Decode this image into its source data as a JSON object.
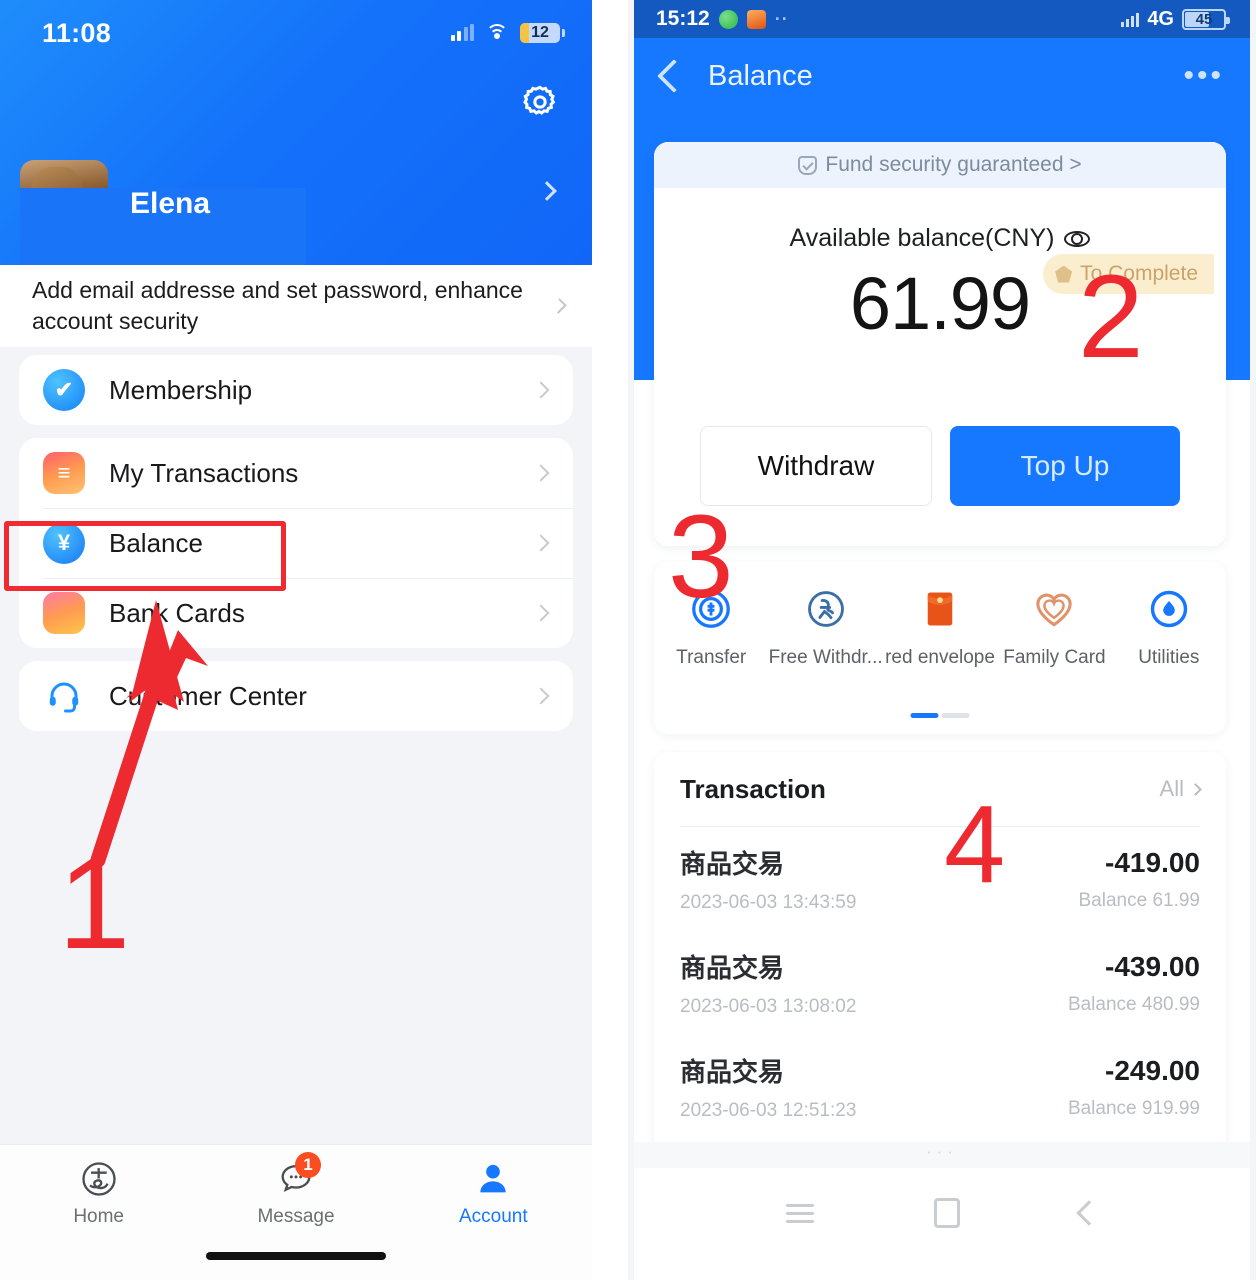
{
  "left_phone": {
    "status_bar": {
      "time": "11:08",
      "battery_percent": "12",
      "signal_icon": "cellular-signal-icon",
      "wifi_icon": "wifi-icon"
    },
    "header": {
      "settings_icon": "gear-icon",
      "user_name": "Elena",
      "chevron_icon": "chevron-right-icon"
    },
    "security_banner": {
      "text": "Add email addresse and set password, enhance account security",
      "chevron_icon": "chevron-right-icon"
    },
    "menu": [
      {
        "label": "Membership",
        "icon": "membership-icon"
      },
      {
        "label": "My Transactions",
        "icon": "transactions-icon"
      },
      {
        "label": "Balance",
        "icon": "balance-yen-icon"
      },
      {
        "label": "Bank Cards",
        "icon": "bank-card-icon"
      },
      {
        "label": "Customer Center",
        "icon": "headset-icon"
      }
    ],
    "tabbar": [
      {
        "label": "Home",
        "icon": "alipay-home-icon",
        "active": false,
        "badge": ""
      },
      {
        "label": "Message",
        "icon": "chat-bubble-icon",
        "active": false,
        "badge": "1"
      },
      {
        "label": "Account",
        "icon": "person-icon",
        "active": true,
        "badge": ""
      }
    ]
  },
  "right_phone": {
    "status_bar": {
      "time": "15:12",
      "network": "4G",
      "battery_percent": "45"
    },
    "appbar": {
      "back_icon": "back-chevron-icon",
      "title": "Balance",
      "more_icon": "more-horizontal-icon"
    },
    "balance_card": {
      "fund_notice": "Fund security guaranteed >",
      "fund_icon": "shield-check-icon",
      "label": "Available balance(CNY)",
      "eye_icon": "eye-icon",
      "amount": "61.99",
      "to_complete_badge": "To Complete",
      "withdraw_label": "Withdraw",
      "topup_label": "Top Up"
    },
    "services": [
      {
        "label": "Transfer",
        "icon": "transfer-icon"
      },
      {
        "label": "Free Withdr...",
        "icon": "free-withdraw-icon"
      },
      {
        "label": "red envelope",
        "icon": "red-envelope-icon"
      },
      {
        "label": "Family Card",
        "icon": "family-card-heart-icon"
      },
      {
        "label": "Utilities",
        "icon": "utilities-drop-icon"
      }
    ],
    "transaction": {
      "title": "Transaction",
      "all_label": "All",
      "all_chevron": "chevron-right-icon",
      "rows": [
        {
          "name": "商品交易",
          "datetime": "2023-06-03 13:43:59",
          "amount": "-419.00",
          "balance": "Balance 61.99"
        },
        {
          "name": "商品交易",
          "datetime": "2023-06-03 13:08:02",
          "amount": "-439.00",
          "balance": "Balance 480.99"
        },
        {
          "name": "商品交易",
          "datetime": "2023-06-03 12:51:23",
          "amount": "-249.00",
          "balance": "Balance 919.99"
        }
      ]
    },
    "navbar": [
      {
        "icon": "menu-icon"
      },
      {
        "icon": "home-square-icon"
      },
      {
        "icon": "back-chevron-icon"
      }
    ]
  },
  "annotations": {
    "step_1": "1",
    "step_2": "2",
    "step_3": "3",
    "step_4": "4",
    "highlight_color": "#ee2a31",
    "arrow_icon": "red-arrow-icon",
    "highlight_target": "Balance"
  }
}
